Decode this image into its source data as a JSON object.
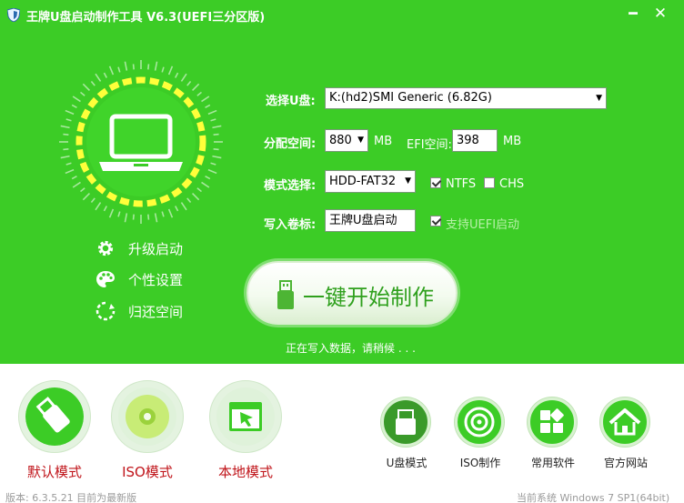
{
  "titlebar": {
    "title": "王牌U盘启动制作工具 V6.3(UEFI三分区版)",
    "minimize_symbol": "━",
    "close_symbol": "✕"
  },
  "icons": {
    "app": "shield-icon",
    "laptop": "laptop-icon",
    "upgrade": "gear-icon",
    "personalize": "palette-icon",
    "restore": "refresh-icon"
  },
  "menu": {
    "upgrade": "升级启动",
    "personalize": "个性设置",
    "restore": "归还空间"
  },
  "form": {
    "usb_label": "选择U盘:",
    "usb_value": "K:(hd2)SMI Generic (6.82G)",
    "alloc_label": "分配空间:",
    "alloc_value": "880",
    "alloc_unit": "MB",
    "efi_label": "EFI空间:",
    "efi_value": "398",
    "efi_unit": "MB",
    "mode_label": "模式选择:",
    "mode_value": "HDD-FAT32",
    "ntfs_label": "NTFS",
    "ntfs_checked": true,
    "chs_label": "CHS",
    "chs_checked": false,
    "volume_label": "写入卷标:",
    "volume_value": "王牌U盘启动",
    "uefi_label": "支持UEFI启动",
    "uefi_checked": true
  },
  "start_button": "一键开始制作",
  "status": "正在写入数据，请稍候 . . .",
  "modes": {
    "default": "默认模式",
    "iso": "ISO模式",
    "local": "本地模式"
  },
  "nav": {
    "udisk": "U盘模式",
    "iso_make": "ISO制作",
    "software": "常用软件",
    "website": "官方网站"
  },
  "footer": {
    "version": "版本: 6.3.5.21   目前为最新版",
    "system": "当前系统  Windows 7 SP1(64bit)"
  },
  "colors": {
    "primary_green": "#3ccc26",
    "ring_yellow": "#ffff3a",
    "mode_label_red": "#c0141a"
  }
}
